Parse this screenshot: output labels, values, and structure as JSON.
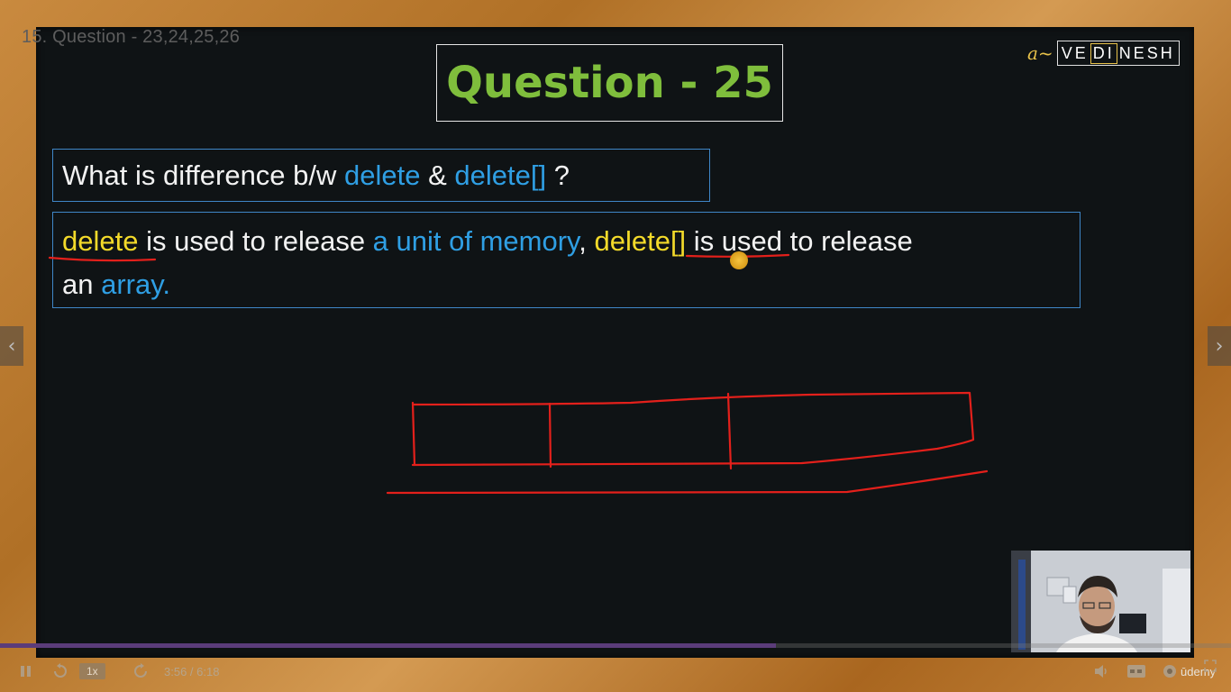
{
  "lecture": {
    "title": "15. Question - 23,24,25,26"
  },
  "slide": {
    "heading": "Question - 25",
    "logo": {
      "swirl": "a~",
      "pre": "VE",
      "boxed": "DI",
      "post": "NESH"
    },
    "question": {
      "p1": "What is difference b/w ",
      "kw1": "delete",
      "p2": " & ",
      "kw2": "delete[]",
      "p3": " ?"
    },
    "answer": {
      "kw1": "delete",
      "p1": " is used to release ",
      "phrase1": "a unit of memory",
      "p2": ", ",
      "kw2": "delete[]",
      "p3": " is used to release",
      "p4": "an ",
      "phrase2": "array."
    }
  },
  "navigation": {
    "prev_icon": "chevron-left-icon",
    "next_icon": "chevron-right-icon",
    "prev_glyph": "‹",
    "next_glyph": "›"
  },
  "player": {
    "progress": 0.63,
    "speed_label": "1x",
    "time_label": "3:56 / 6:18",
    "brand": "ūdemy",
    "icons": [
      "pause-icon",
      "rewind-icon",
      "forward-icon",
      "volume-icon",
      "captions-icon",
      "settings-icon",
      "fullscreen-icon"
    ]
  },
  "colors": {
    "accent_green": "#7fbe3c",
    "keyword_blue": "#2f9fe4",
    "keyword_yellow": "#f3da2a",
    "ink_red": "#e3201b"
  }
}
